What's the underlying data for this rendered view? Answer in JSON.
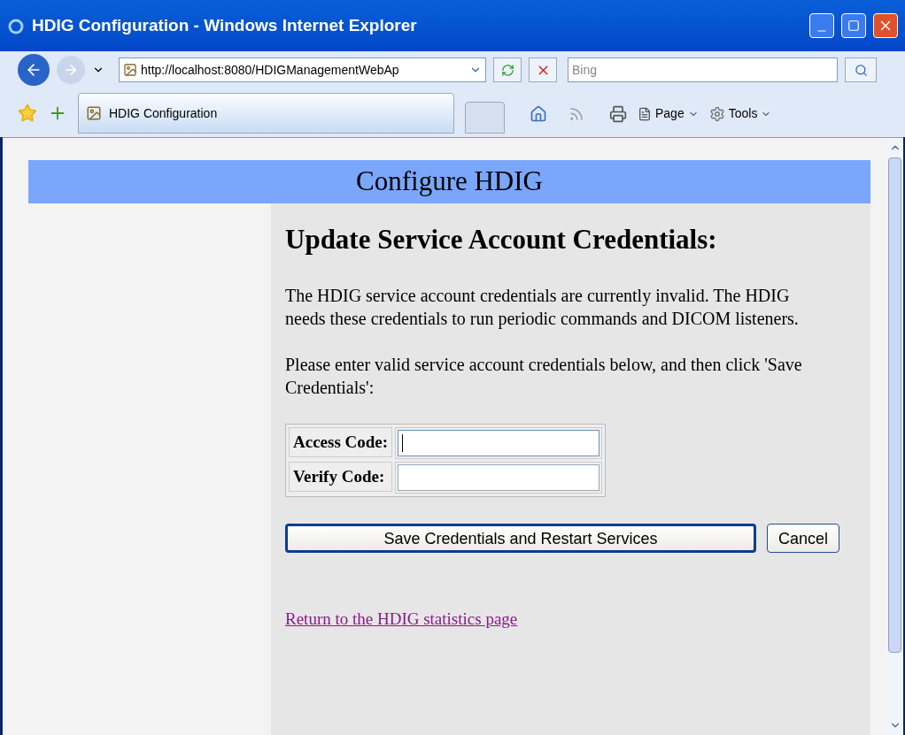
{
  "window": {
    "title": "HDIG Configuration - Windows Internet Explorer"
  },
  "address_bar": {
    "url": "http://localhost:8080/HDIGManagementWebAp"
  },
  "search": {
    "placeholder": "Bing"
  },
  "tabs": [
    {
      "label": "HDIG Configuration",
      "selected": true
    }
  ],
  "command_bar": [
    {
      "label": "Page"
    },
    {
      "label": "Tools"
    }
  ],
  "page": {
    "banner": "Configure HDIG",
    "heading": "Update Service Account Credentials:",
    "paragraphs": [
      "The HDIG service account credentials are currently invalid. The HDIG needs these credentials to run periodic commands and DICOM listeners.",
      "Please enter valid service account credentials below, and then click 'Save Credentials':"
    ],
    "fields": [
      {
        "label": "Access Code:",
        "focused": true
      },
      {
        "label": "Verify Code:",
        "focused": false
      }
    ],
    "buttons": [
      {
        "label": "Save Credentials and Restart Services",
        "default": true
      },
      {
        "label": "Cancel",
        "default": false
      }
    ],
    "link": "Return to the HDIG statistics page"
  }
}
